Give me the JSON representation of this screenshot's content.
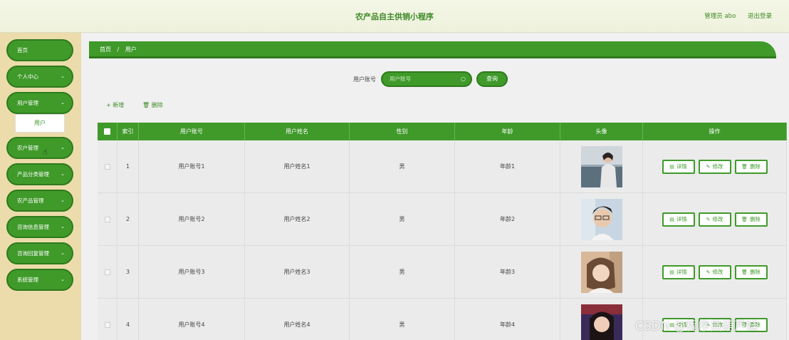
{
  "header": {
    "title": "农产品自主供销小程序",
    "user_label": "管理员 abo",
    "logout_label": "退出登录"
  },
  "sidebar": {
    "items": [
      {
        "label": "首页",
        "has_chevron": false
      },
      {
        "label": "个人中心",
        "has_chevron": true
      },
      {
        "label": "用户管理",
        "has_chevron": true
      },
      {
        "label": "农户管理",
        "has_chevron": true
      },
      {
        "label": "产品分类管理",
        "has_chevron": true
      },
      {
        "label": "农产品管理",
        "has_chevron": true
      },
      {
        "label": "咨询信息管理",
        "has_chevron": true
      },
      {
        "label": "咨询回复管理",
        "has_chevron": true
      },
      {
        "label": "系统管理",
        "has_chevron": true
      }
    ],
    "submenu_item": "用户"
  },
  "breadcrumb": {
    "home": "首页",
    "separator": "/",
    "current": "用户"
  },
  "search": {
    "label": "用户账号",
    "placeholder": "用户账号",
    "button": "查询"
  },
  "actions": {
    "add": "新增",
    "delete": "删除",
    "add_icon": "+",
    "delete_icon": "🗑"
  },
  "table": {
    "columns": [
      "索引",
      "用户账号",
      "用户姓名",
      "性别",
      "年龄",
      "头像",
      "操作"
    ],
    "row_buttons": {
      "detail": "详情",
      "edit": "修改",
      "delete": "删除"
    },
    "rows": [
      {
        "index": "1",
        "account": "用户账号1",
        "name": "用户姓名1",
        "gender": "男",
        "age": "年龄1"
      },
      {
        "index": "2",
        "account": "用户账号2",
        "name": "用户姓名2",
        "gender": "男",
        "age": "年龄2"
      },
      {
        "index": "3",
        "account": "用户账号3",
        "name": "用户姓名3",
        "gender": "男",
        "age": "年龄3"
      },
      {
        "index": "4",
        "account": "用户账号4",
        "name": "用户姓名4",
        "gender": "男",
        "age": "年龄4"
      }
    ]
  },
  "watermark": "CSDN @程序员葫芦娃",
  "colors": {
    "accent": "#3f9a2a",
    "accent_dark": "#2f7a1d",
    "sidebar_bg": "#ecdcab",
    "header_bg": "#f1f4e2"
  }
}
